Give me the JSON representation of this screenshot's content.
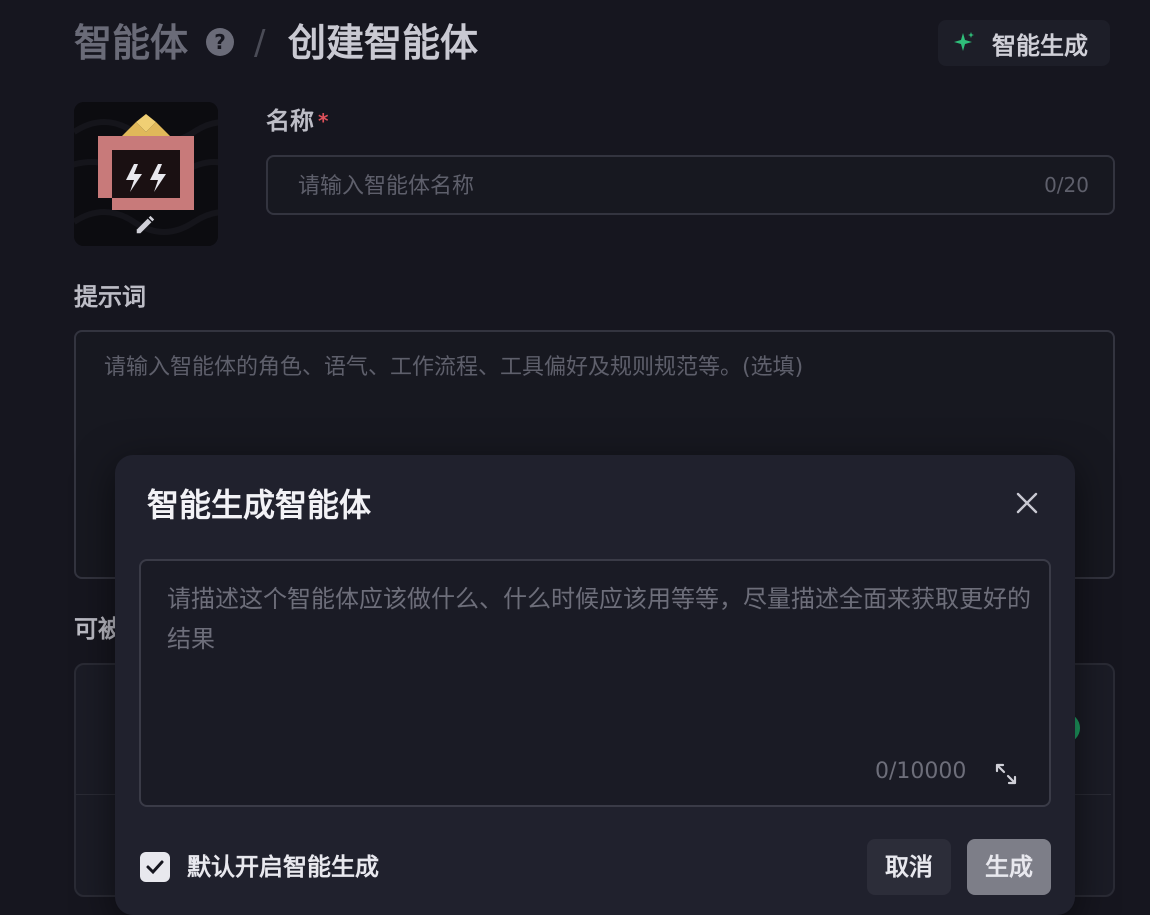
{
  "header": {
    "breadcrumb_root": "智能体",
    "breadcrumb_separator": "/",
    "page_title": "创建智能体",
    "ai_generate_label": "智能生成",
    "help_icon": "help-circle-icon",
    "spark_icon": "sparkle-icon"
  },
  "form": {
    "name_label": "名称",
    "required_mark": "*",
    "name_placeholder": "请输入智能体名称",
    "name_value": "",
    "name_counter": "0/20",
    "prompt_label": "提示词",
    "prompt_placeholder": "请输入智能体的角色、语气、工作流程、工具偏好及规则规范等。(选填)",
    "prompt_value": "",
    "partial_section_label": "可被"
  },
  "modal": {
    "title": "智能生成智能体",
    "description_placeholder": "请描述这个智能体应该做什么、什么时候应该用等等，尽量描述全面来获取更好的结果",
    "description_value": "",
    "description_counter": "0/10000",
    "checkbox_label": "默认开启智能生成",
    "checkbox_checked": true,
    "cancel_label": "取消",
    "generate_label": "生成"
  },
  "colors": {
    "background": "#16161f",
    "modal_bg": "#20212d",
    "accent_green": "#2fbf7a",
    "required_red": "#e0515b",
    "avatar_pink": "#c87a7a",
    "avatar_gold": "#e0b85a"
  }
}
